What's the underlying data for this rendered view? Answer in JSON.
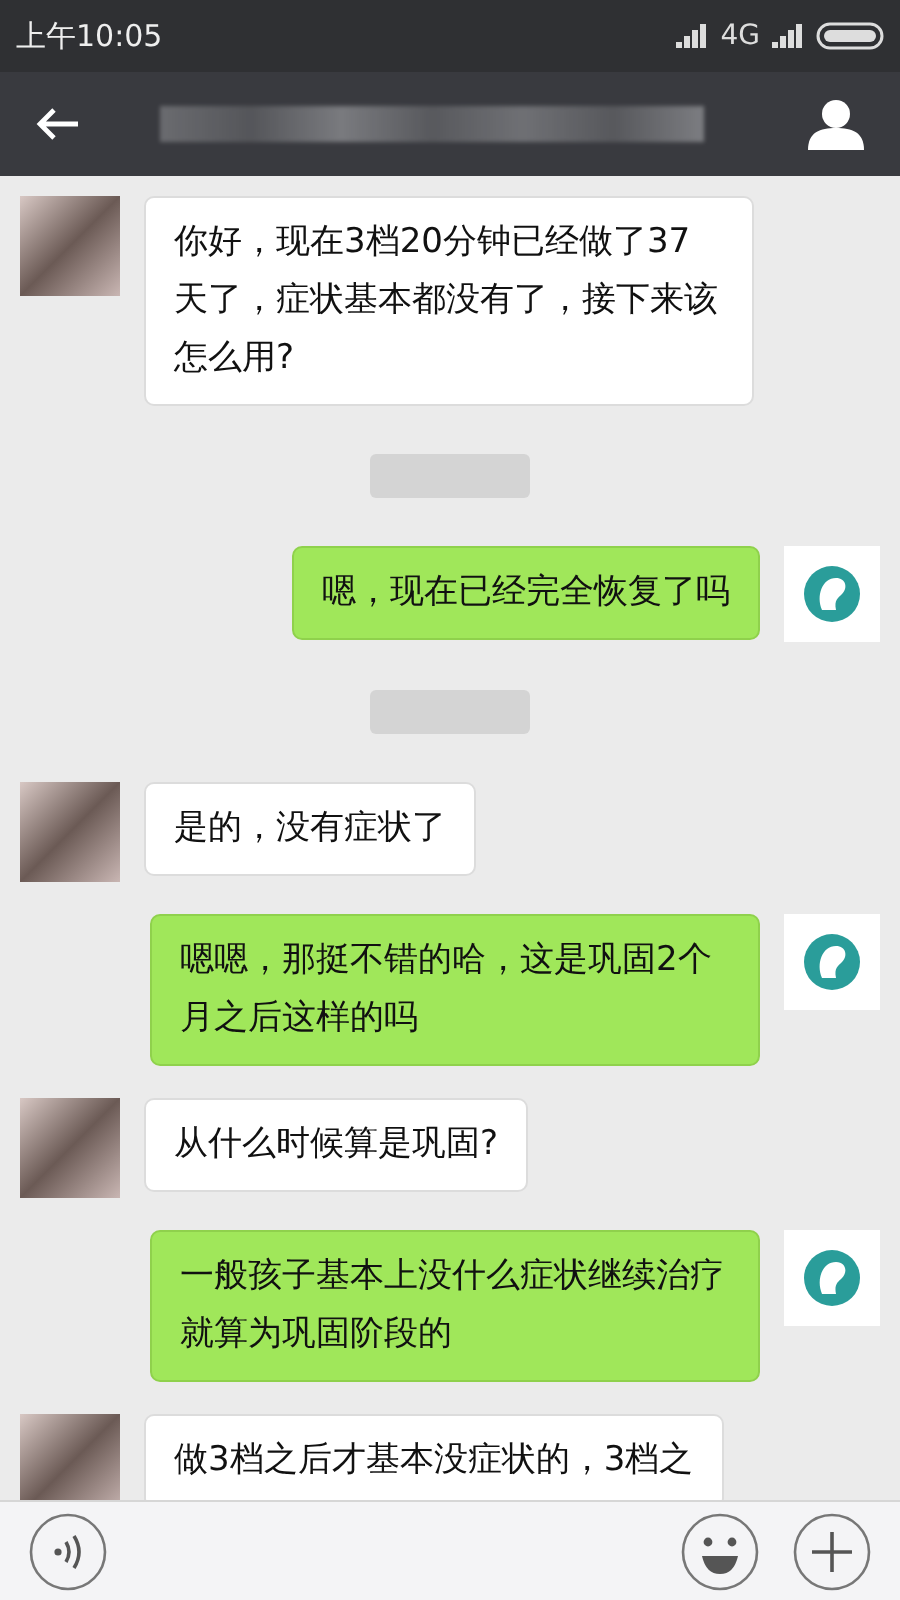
{
  "status_bar": {
    "time": "上午10:05",
    "network": "4G"
  },
  "messages": [
    {
      "kind": "received",
      "text": "你好，现在3档20分钟已经做了37天了，症状基本都没有了，接下来该怎么用?"
    },
    {
      "kind": "timestamp"
    },
    {
      "kind": "sent",
      "text": "嗯，现在已经完全恢复了吗"
    },
    {
      "kind": "timestamp"
    },
    {
      "kind": "received",
      "text": "是的，没有症状了"
    },
    {
      "kind": "sent",
      "text": "嗯嗯，那挺不错的哈，这是巩固2个月之后这样的吗"
    },
    {
      "kind": "received",
      "text": "从什么时候算是巩固?"
    },
    {
      "kind": "sent",
      "text": "一般孩子基本上没什么症状继续治疗就算为巩固阶段的"
    },
    {
      "kind": "received",
      "text": "做3档之后才基本没症状的，3档之"
    }
  ]
}
